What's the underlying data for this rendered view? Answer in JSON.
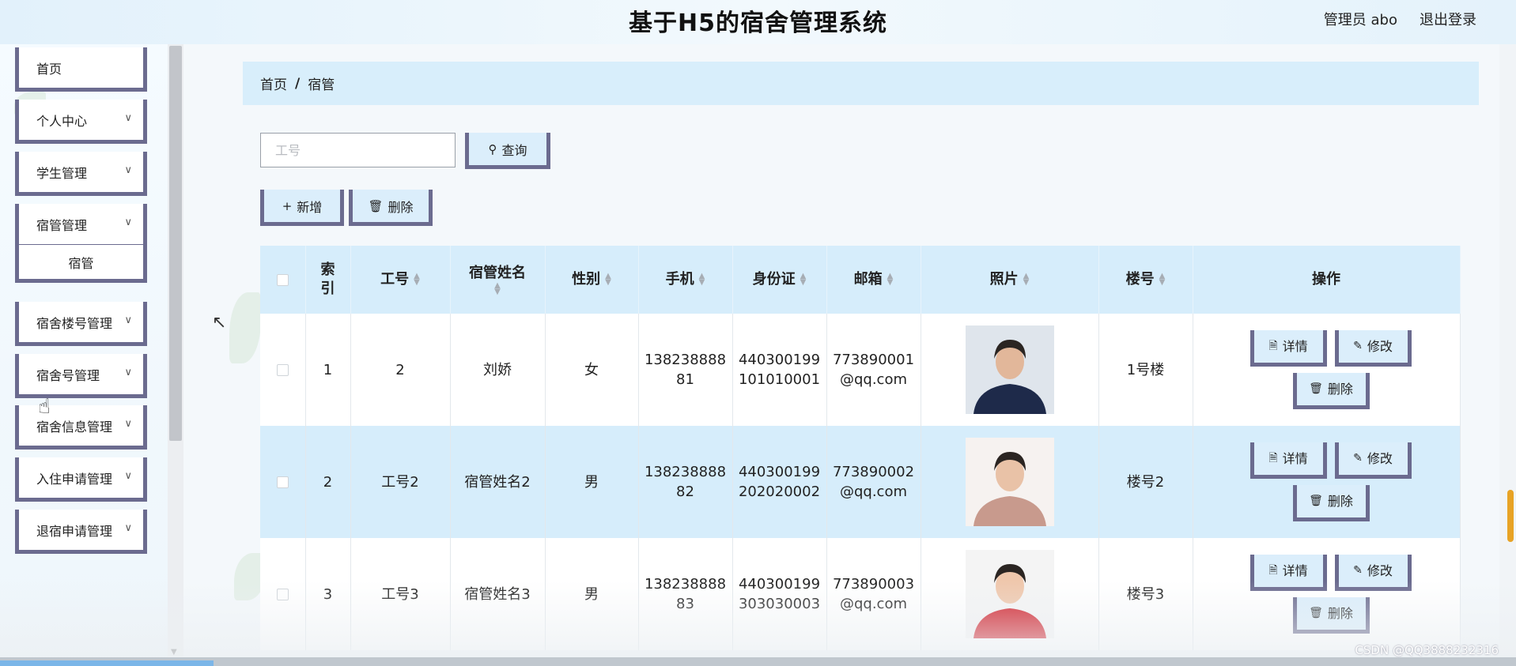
{
  "header": {
    "title": "基于H5的宿舍管理系统",
    "user": "管理员 abo",
    "logout": "退出登录"
  },
  "sidebar": {
    "items": [
      {
        "label": "首页",
        "chevron": false
      },
      {
        "label": "个人中心",
        "chevron": true
      },
      {
        "label": "学生管理",
        "chevron": true
      },
      {
        "label": "宿管管理",
        "chevron": true
      },
      {
        "label": "宿管",
        "chevron": false,
        "sub": true
      },
      {
        "label": "宿舍楼号管理",
        "chevron": true
      },
      {
        "label": "宿舍号管理",
        "chevron": true
      },
      {
        "label": "宿舍信息管理",
        "chevron": true
      },
      {
        "label": "入住申请管理",
        "chevron": true
      },
      {
        "label": "退宿申请管理",
        "chevron": true
      }
    ]
  },
  "breadcrumb": {
    "home": "首页",
    "sep": "/",
    "current": "宿管"
  },
  "search": {
    "placeholder": "工号",
    "value": "",
    "button": "查询"
  },
  "toolbar": {
    "add": "新增",
    "delete": "删除"
  },
  "table": {
    "headers": {
      "index": "索引",
      "job_no": "工号",
      "name": "宿管姓名",
      "gender": "性别",
      "phone": "手机",
      "id_card": "身份证",
      "email": "邮箱",
      "photo": "照片",
      "building": "楼号",
      "ops": "操作"
    },
    "rows": [
      {
        "index": "1",
        "job_no": "2",
        "name": "刘娇",
        "gender": "女",
        "phone": "13823888881",
        "id_card": "440300199101010001",
        "email": "773890001@qq.com",
        "building": "1号楼",
        "photo_colors": [
          "#dfe5ec",
          "#1e2a4a",
          "#e2b79a"
        ]
      },
      {
        "index": "2",
        "job_no": "工号2",
        "name": "宿管姓名2",
        "gender": "男",
        "phone": "13823888882",
        "id_card": "440300199202020002",
        "email": "773890002@qq.com",
        "building": "楼号2",
        "photo_colors": [
          "#f6f2f0",
          "#c89a8d",
          "#e9c2a7"
        ]
      },
      {
        "index": "3",
        "job_no": "工号3",
        "name": "宿管姓名3",
        "gender": "男",
        "phone": "13823888883",
        "id_card": "440300199303030003",
        "email": "773890003@qq.com",
        "building": "楼号3",
        "photo_colors": [
          "#f4f4f4",
          "#d0202a",
          "#efc7ac"
        ]
      }
    ],
    "row_buttons": {
      "detail": "详情",
      "edit": "修改",
      "delete": "删除"
    }
  },
  "watermark": "CSDN @QQ3888232316"
}
